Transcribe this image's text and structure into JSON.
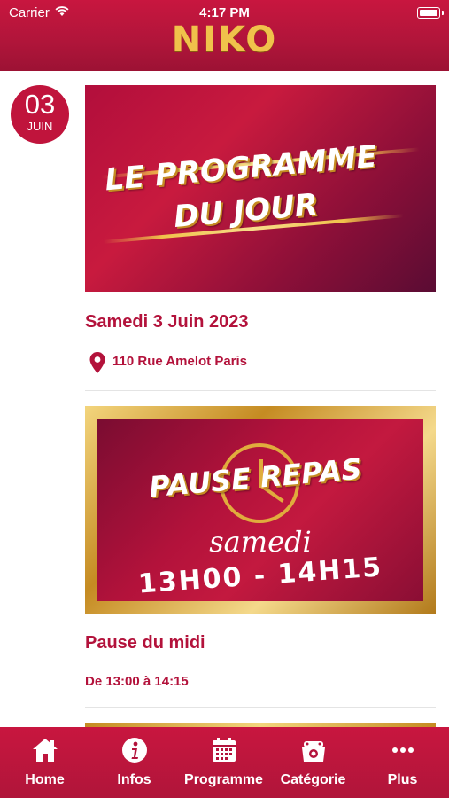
{
  "status_bar": {
    "carrier": "Carrier",
    "time": "4:17 PM"
  },
  "header": {
    "logo": "NIKO"
  },
  "date_badge": {
    "day": "03",
    "month": "JUIN"
  },
  "cards": [
    {
      "image_title_line1": "LE PROGRAMME",
      "image_title_line2": "DU JOUR",
      "title": "Samedi 3 Juin 2023",
      "location": "110 Rue Amelot Paris"
    },
    {
      "image_title": "PAUSE REPAS",
      "image_day": "samedi",
      "image_hours": "13H00 - 14H15",
      "title": "Pause du midi",
      "time_range": "De 13:00 à 14:15"
    }
  ],
  "tabbar": {
    "items": [
      {
        "label": "Home",
        "icon": "home-icon"
      },
      {
        "label": "Infos",
        "icon": "info-icon"
      },
      {
        "label": "Programme",
        "icon": "calendar-icon"
      },
      {
        "label": "Catégorie",
        "icon": "category-icon"
      },
      {
        "label": "Plus",
        "icon": "more-icon"
      }
    ]
  },
  "colors": {
    "brand": "#b3123b",
    "gold": "#f0c24b"
  }
}
